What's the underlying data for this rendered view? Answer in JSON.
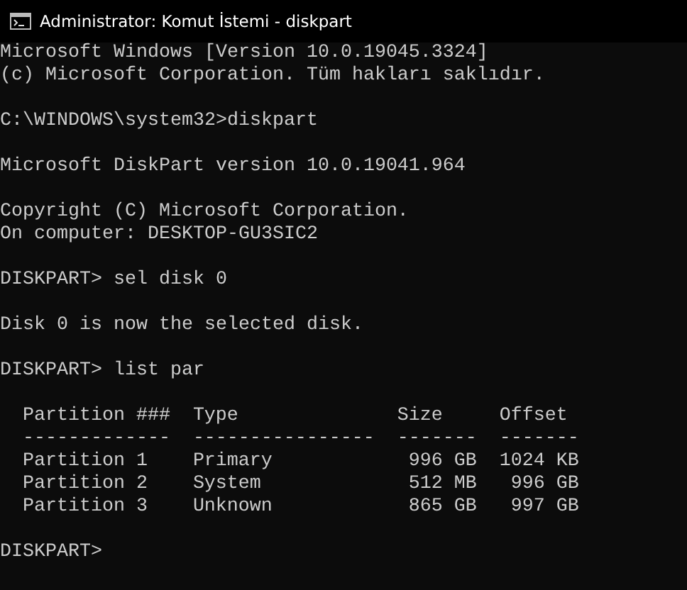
{
  "window": {
    "title": "Administrator: Komut İstemi - diskpart"
  },
  "console": [
    {
      "kind": "text",
      "lines": [
        "Microsoft Windows [Version 10.0.19045.3324]",
        "(c) Microsoft Corporation. Tüm hakları saklıdır."
      ]
    },
    {
      "kind": "text",
      "lines": [
        "C:\\WINDOWS\\system32>diskpart"
      ]
    },
    {
      "kind": "text",
      "lines": [
        "Microsoft DiskPart version 10.0.19041.964"
      ]
    },
    {
      "kind": "text",
      "lines": [
        "Copyright (C) Microsoft Corporation.",
        "On computer: DESKTOP-GU3SIC2"
      ]
    },
    {
      "kind": "text",
      "lines": [
        "DISKPART> sel disk 0"
      ]
    },
    {
      "kind": "text",
      "lines": [
        "Disk 0 is now the selected disk."
      ]
    },
    {
      "kind": "text",
      "lines": [
        "DISKPART> list par"
      ]
    },
    {
      "kind": "table",
      "columns": [
        "Partition ###",
        "Type",
        "Size",
        "Offset"
      ],
      "rules": [
        "-------------",
        "----------------",
        "-------",
        "-------"
      ],
      "rows": [
        [
          "Partition 1",
          "Primary",
          "996 GB",
          "1024 KB"
        ],
        [
          "Partition 2",
          "System",
          "512 MB",
          "996 GB"
        ],
        [
          "Partition 3",
          "Unknown",
          "865 GB",
          "997 GB"
        ]
      ]
    },
    {
      "kind": "text",
      "lines": [
        "DISKPART>"
      ]
    }
  ]
}
